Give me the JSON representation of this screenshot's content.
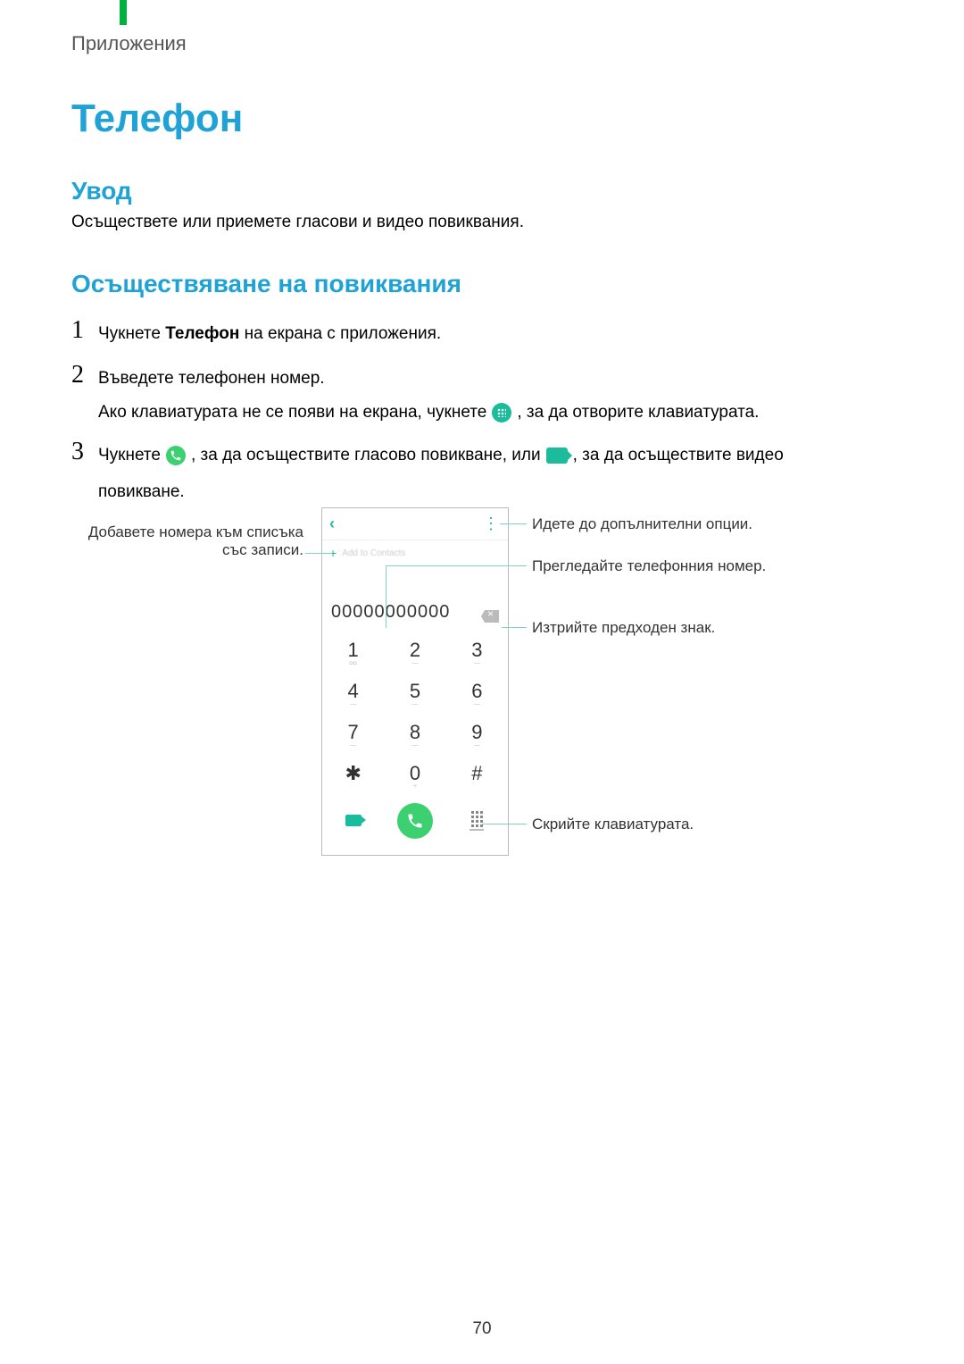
{
  "header": {
    "section": "Приложения"
  },
  "title": "Телефон",
  "intro": {
    "heading": "Увод",
    "text": "Осъществете или приемете гласови и видео повиквания."
  },
  "section2": {
    "heading": "Осъществяване на повиквания"
  },
  "steps": {
    "s1": {
      "num": "1",
      "pre": "Чукнете ",
      "bold": "Телефон",
      "post": " на екрана с приложения."
    },
    "s2": {
      "num": "2",
      "line1": "Въведете телефонен номер.",
      "line2a": "Ако клавиатурата не се появи на екрана, чукнете ",
      "line2b": ", за да отворите клавиатурата."
    },
    "s3": {
      "num": "3",
      "a": "Чукнете ",
      "b": ", за да осъществите гласово повикване, или ",
      "c": ", за да осъществите видео",
      "d": "повикване."
    }
  },
  "phone": {
    "entered_number": "00000000000",
    "add_to_contacts": "Add to Contacts",
    "keys": {
      "k1": "1",
      "k2": "2",
      "k3": "3",
      "k4": "4",
      "k5": "5",
      "k6": "6",
      "k7": "7",
      "k8": "8",
      "k9": "9",
      "kstar": "✱",
      "k0": "0",
      "khash": "#",
      "k0sub": "+"
    }
  },
  "callouts": {
    "add_contacts": "Добавете номера към списъка със записи.",
    "more_options": "Идете до допълнителни опции.",
    "review_number": "Прегледайте телефонния номер.",
    "delete_char": "Изтрийте предходен знак.",
    "hide_keyboard": "Скрийте клавиатурата."
  },
  "page_number": "70"
}
